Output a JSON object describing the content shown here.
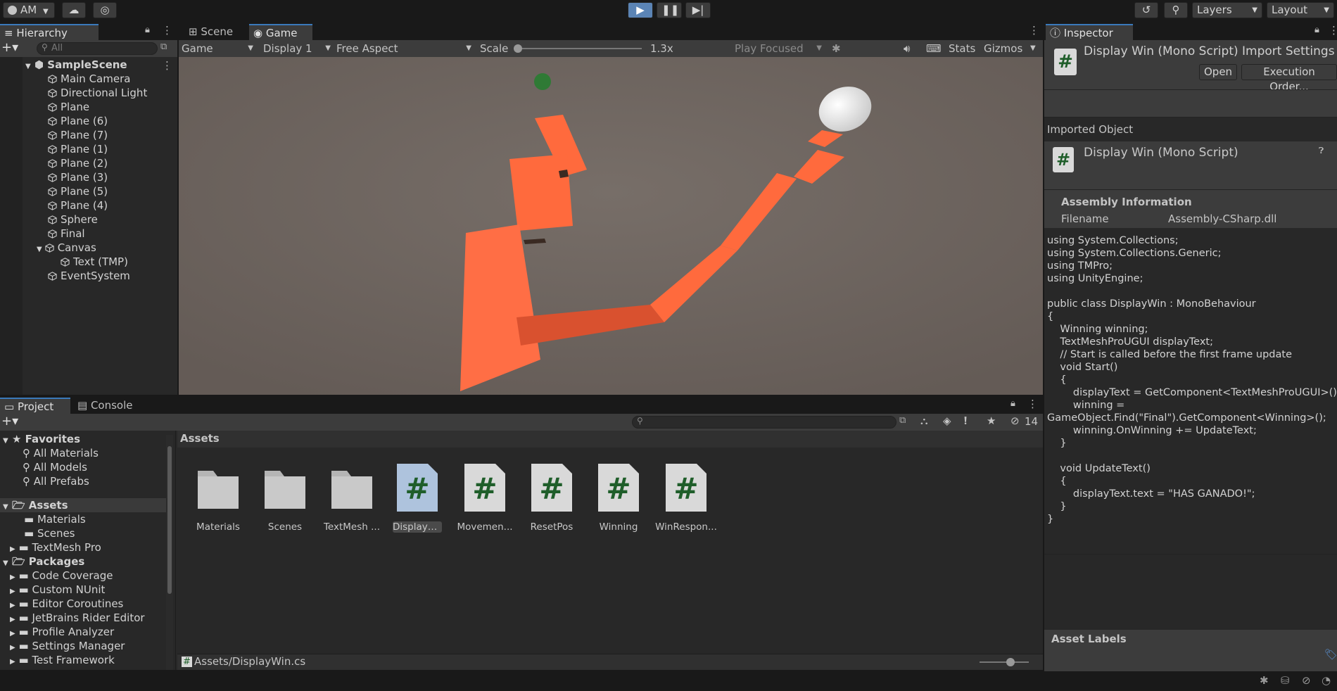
{
  "topbar": {
    "account": "AM",
    "layers": "Layers",
    "layout": "Layout"
  },
  "hierarchy": {
    "tab": "Hierarchy",
    "search_placeholder": "All",
    "scene": "SampleScene",
    "items": [
      {
        "label": "Main Camera"
      },
      {
        "label": "Directional Light"
      },
      {
        "label": "Plane"
      },
      {
        "label": "Plane (6)"
      },
      {
        "label": "Plane (7)"
      },
      {
        "label": "Plane (1)"
      },
      {
        "label": "Plane (2)"
      },
      {
        "label": "Plane (3)"
      },
      {
        "label": "Plane (5)"
      },
      {
        "label": "Plane (4)"
      },
      {
        "label": "Sphere"
      },
      {
        "label": "Final"
      },
      {
        "label": "Canvas"
      },
      {
        "label": "Text (TMP)"
      },
      {
        "label": "EventSystem"
      }
    ]
  },
  "scene_tabs": {
    "scene": "Scene",
    "game": "Game"
  },
  "game_toolbar": {
    "game": "Game",
    "display": "Display 1",
    "aspect": "Free Aspect",
    "scale_label": "Scale",
    "scale_value": "1.3x",
    "play_focused": "Play Focused",
    "stats": "Stats",
    "gizmos": "Gizmos"
  },
  "project": {
    "tab": "Project",
    "console_tab": "Console",
    "hidden_count": "14",
    "favorites": "Favorites",
    "fav_items": [
      {
        "label": "All Materials"
      },
      {
        "label": "All Models"
      },
      {
        "label": "All Prefabs"
      }
    ],
    "assets": "Assets",
    "asset_folders": [
      {
        "label": "Materials"
      },
      {
        "label": "Scenes"
      },
      {
        "label": "TextMesh Pro"
      }
    ],
    "packages": "Packages",
    "package_items": [
      {
        "label": "Code Coverage"
      },
      {
        "label": "Custom NUnit"
      },
      {
        "label": "Editor Coroutines"
      },
      {
        "label": "JetBrains Rider Editor"
      },
      {
        "label": "Profile Analyzer"
      },
      {
        "label": "Settings Manager"
      },
      {
        "label": "Test Framework"
      }
    ],
    "breadcrumb": "Assets",
    "grid": [
      {
        "label": "Materials"
      },
      {
        "label": "Scenes"
      },
      {
        "label": "TextMesh ..."
      },
      {
        "label": "DisplayWin"
      },
      {
        "label": "Movemen..."
      },
      {
        "label": "ResetPos"
      },
      {
        "label": "Winning"
      },
      {
        "label": "WinRespon..."
      }
    ],
    "path": "Assets/DisplayWin.cs"
  },
  "inspector": {
    "tab": "Inspector",
    "title": "Display Win (Mono Script) Import Settings",
    "open": "Open",
    "execution_order": "Execution Order...",
    "imported_object": "Imported Object",
    "object_name": "Display Win (Mono Script)",
    "assembly_info": "Assembly Information",
    "filename_label": "Filename",
    "filename_value": "Assembly-CSharp.dll",
    "code": "using System.Collections;\nusing System.Collections.Generic;\nusing TMPro;\nusing UnityEngine;\n\npublic class DisplayWin : MonoBehaviour\n{\n    Winning winning;\n    TextMeshProUGUI displayText;\n    // Start is called before the first frame update\n    void Start()\n    {\n        displayText = GetComponent<TextMeshProUGUI>();\n        winning =\nGameObject.Find(\"Final\").GetComponent<Winning>();\n        winning.OnWinning += UpdateText;\n    }\n\n    void UpdateText()\n    {\n        displayText.text = \"HAS GANADO!\";\n    }\n}",
    "asset_labels": "Asset Labels"
  },
  "colors": {
    "accent": "#3a79bb",
    "platform": "#ff6a3d",
    "ground": "#6e6560",
    "script_icon": "#1f5e2a"
  }
}
